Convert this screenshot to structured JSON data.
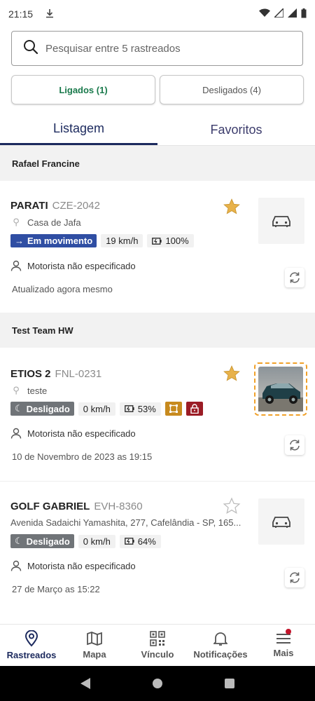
{
  "status": {
    "time": "21:15"
  },
  "search": {
    "placeholder": "Pesquisar entre 5 rastreados"
  },
  "filters": {
    "on_label": "Ligados (1)",
    "off_label": "Desligados (4)"
  },
  "tabs": [
    {
      "label": "Listagem"
    },
    {
      "label": "Favoritos"
    }
  ],
  "groups": [
    {
      "name": "Rafael Francine"
    },
    {
      "name": "Test Team HW"
    }
  ],
  "vehicles": [
    {
      "name": "PARATI",
      "plate": "CZE-2042",
      "location": "Casa de Jafa",
      "status": "Em movimento",
      "speed": "19 km/h",
      "battery": "100%",
      "driver": "Motorista não especificado",
      "updated": "Atualizado agora mesmo",
      "favorite": true
    },
    {
      "name": "ETIOS 2",
      "plate": "FNL-0231",
      "location": "teste",
      "status": "Desligado",
      "speed": "0 km/h",
      "battery": "53%",
      "driver": "Motorista não especificado",
      "updated": "10 de Novembro de 2023 as 19:15",
      "favorite": true
    },
    {
      "name": "GOLF GABRIEL",
      "plate": "EVH-8360",
      "location": "Avenida Sadaichi Yamashita, 277, Cafelândia - SP, 165...",
      "status": "Desligado",
      "speed": "0 km/h",
      "battery": "64%",
      "driver": "Motorista não especificado",
      "updated": "27 de Março as 15:22",
      "favorite": false
    }
  ],
  "nav": [
    {
      "label": "Rastreados",
      "icon": "pin-icon"
    },
    {
      "label": "Mapa",
      "icon": "map-icon"
    },
    {
      "label": "Vínculo",
      "icon": "qr-icon"
    },
    {
      "label": "Notificações",
      "icon": "bell-icon"
    },
    {
      "label": "Mais",
      "icon": "menu-icon"
    }
  ],
  "colors": {
    "primary": "#1c2a5e",
    "moving": "#2f4ea3",
    "off": "#707478",
    "favorite": "#e8b24a",
    "on_green": "#1a7a4c"
  }
}
